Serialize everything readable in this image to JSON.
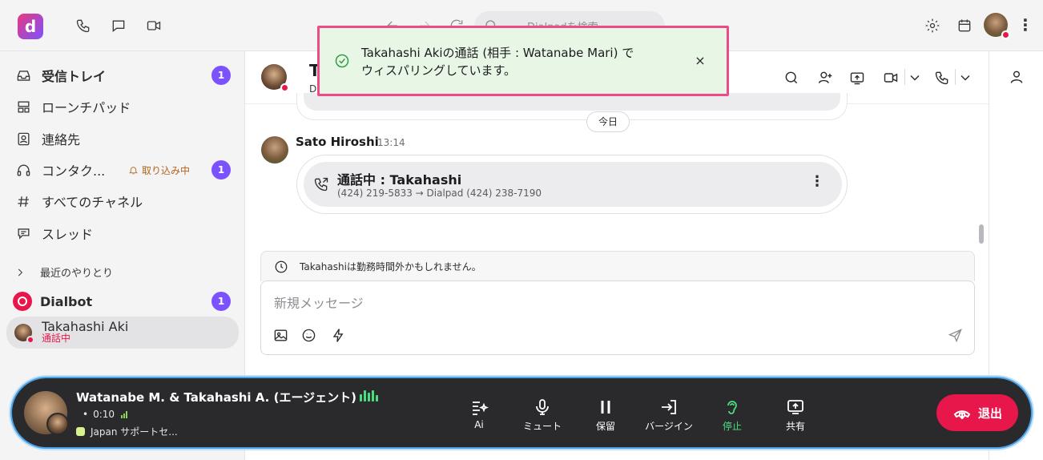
{
  "app": {
    "logo_letter": "d",
    "brand_gradient": [
      "#e9387f",
      "#7c52ff"
    ]
  },
  "topbar": {
    "search_placeholder": "Dialpadを検索"
  },
  "sidebar": {
    "items": [
      {
        "label": "受信トレイ",
        "badge": "1"
      },
      {
        "label": "ローンチパッド"
      },
      {
        "label": "連絡先"
      },
      {
        "label": "コンタク...",
        "status": "取り込み中",
        "badge": "1"
      },
      {
        "label": "すべてのチャネル"
      },
      {
        "label": "スレッド"
      }
    ],
    "recent_header": "最近のやりとり",
    "dialbot": {
      "label": "Dialbot",
      "badge": "1"
    },
    "active_contact": {
      "name": "Takahashi Aki",
      "status": "通話中"
    }
  },
  "chat": {
    "header_initial": "T",
    "header_sub": "D",
    "day_separator": "今日",
    "message": {
      "sender": "Sato Hiroshi",
      "time": "13:14",
      "call_title": "通話中 : Takahashi",
      "call_detail": "(424) 219-5833 → Dialpad (424) 238-7190"
    },
    "ooo_notice": "Takahashiは勤務時間外かもしれません。",
    "composer_placeholder": "新規メッセージ"
  },
  "toast": {
    "line1": "Takahashi Akiの通話 (相手 : Watanabe Mari) で",
    "line2": "ウィスパリングしています。",
    "close": "×"
  },
  "callbar": {
    "title": "Watanabe M. & Takahashi A. (エージェント)",
    "timer": "0:10",
    "queue": "Japan サポートセ...",
    "buttons": [
      {
        "label": "Ai"
      },
      {
        "label": "ミュート"
      },
      {
        "label": "保留"
      },
      {
        "label": "バージイン"
      },
      {
        "label": "停止",
        "active": true
      },
      {
        "label": "共有"
      }
    ],
    "leave_label": "退出",
    "accent": "#4ade80",
    "leave_color": "#e8174b"
  }
}
